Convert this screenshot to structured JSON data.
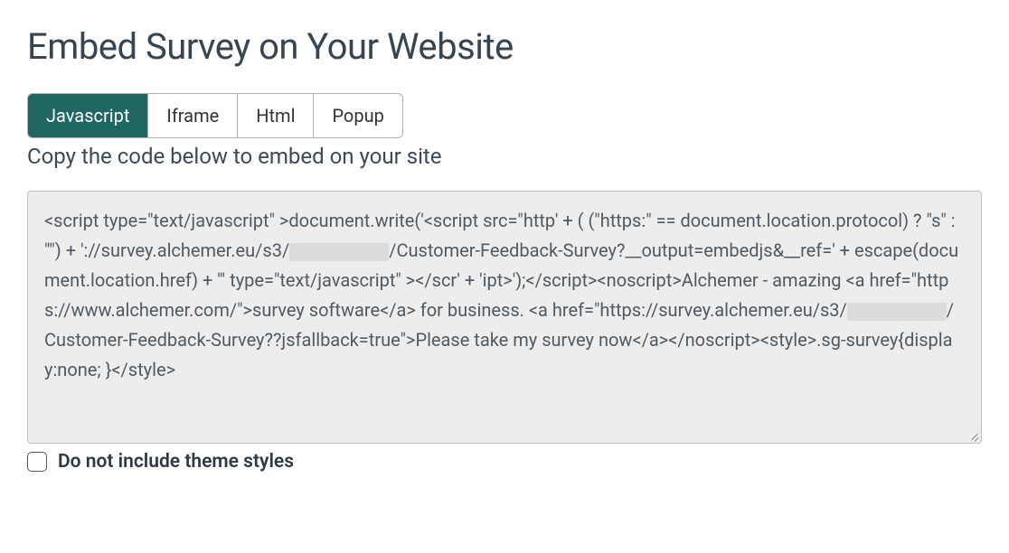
{
  "title": "Embed Survey on Your Website",
  "tabs": {
    "items": [
      {
        "label": "Javascript",
        "active": true
      },
      {
        "label": "Iframe",
        "active": false
      },
      {
        "label": "Html",
        "active": false
      },
      {
        "label": "Popup",
        "active": false
      }
    ]
  },
  "instruction": "Copy the code below to embed on your site",
  "code": {
    "seg1": "<script type=\"text/javascript\" >document.write('<script src=\"http' + ( (\"https:\" == document.location.protocol) ? \"s\" : \"\") + '://survey.alchemer.eu/s3/",
    "seg2": "/Customer-Feedback-Survey?__output=embedjs&__ref=' + escape(document.location.href) + '\" type=\"text/javascript\" ></scr' + 'ipt>');</script><noscript>Alchemer - amazing <a href=\"https://www.alchemer.com/\">survey software</a> for business. <a href=\"https://survey.alchemer.eu/s3/",
    "seg3": "/Customer-Feedback-Survey??jsfallback=true\">Please take my survey now</a></noscript><style>.sg-survey{display:none; }</style>"
  },
  "checkbox": {
    "label": "Do not include theme styles",
    "checked": false
  }
}
